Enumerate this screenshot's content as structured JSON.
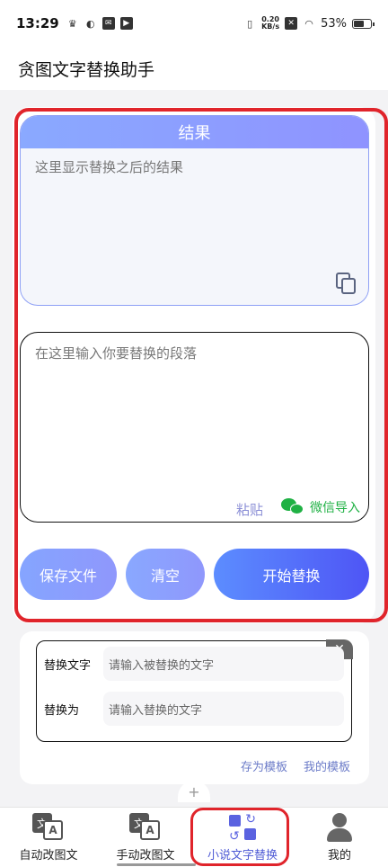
{
  "status_bar": {
    "time": "13:29",
    "net_speed_value": "0.20",
    "net_speed_unit": "KB/s",
    "battery_percent": "53%",
    "battery_level": 0.53
  },
  "app": {
    "title": "贪图文字替换助手"
  },
  "result": {
    "header": "结果",
    "placeholder": "这里显示替换之后的结果"
  },
  "input": {
    "placeholder": "在这里输入你要替换的段落",
    "paste_label": "粘贴",
    "wechat_import_label": "微信导入"
  },
  "actions": {
    "save_label": "保存文件",
    "clear_label": "清空",
    "start_label": "开始替换"
  },
  "rule": {
    "replace_label": "替换文字",
    "replace_placeholder": "请输入被替换的文字",
    "with_label": "替换为",
    "with_placeholder": "请输入替换的文字",
    "close_glyph": "✕"
  },
  "templates": {
    "save_as_label": "存为模板",
    "my_templates_label": "我的模板",
    "add_glyph": "+"
  },
  "bottom_nav": {
    "items": [
      {
        "label": "自动改图文",
        "icon": "translate-icon",
        "glyph_a": "文",
        "glyph_b": "A"
      },
      {
        "label": "手动改图文",
        "icon": "translate-icon",
        "glyph_a": "文",
        "glyph_b": "A"
      },
      {
        "label": "小说文字替换",
        "icon": "swap-icon",
        "active": true
      },
      {
        "label": "我的",
        "icon": "user-icon"
      }
    ]
  },
  "colors": {
    "accent": "#4f5bd5",
    "highlight": "#e0242b",
    "wechat": "#1fb144"
  }
}
